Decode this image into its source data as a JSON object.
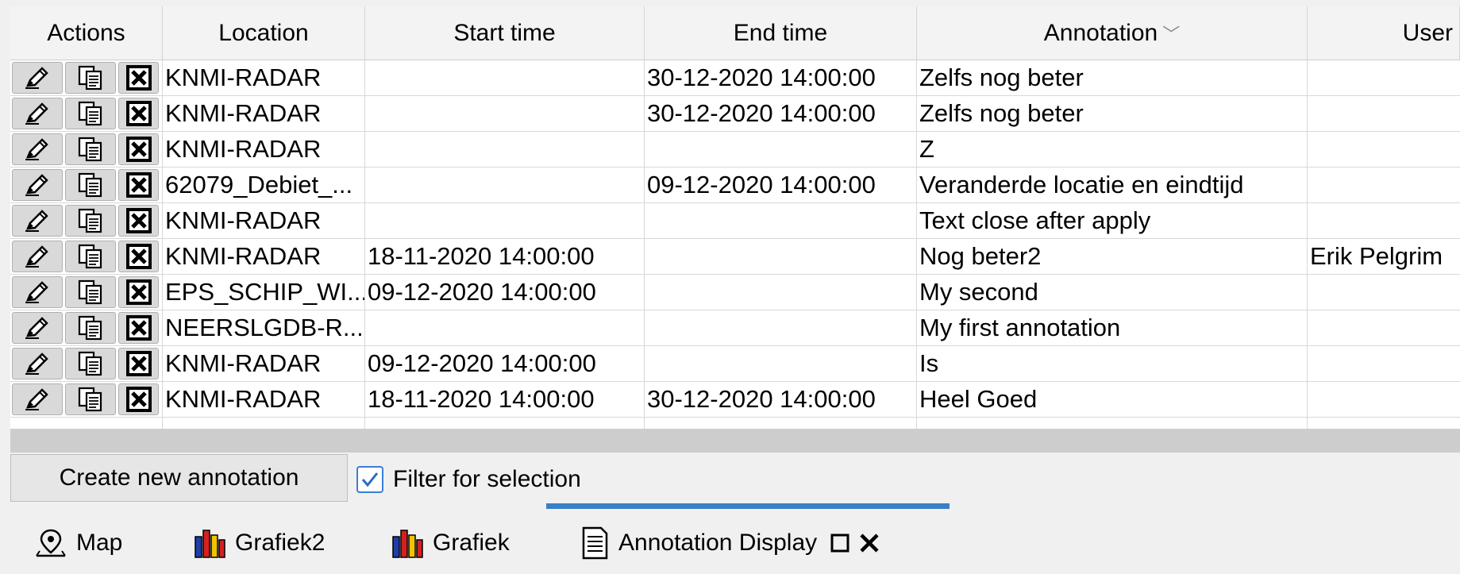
{
  "table": {
    "headers": {
      "actions": "Actions",
      "location": "Location",
      "start": "Start time",
      "end": "End time",
      "annotation": "Annotation",
      "user": "User"
    },
    "rows": [
      {
        "location": "KNMI-RADAR",
        "start": "",
        "end": "30-12-2020 14:00:00",
        "annotation": "Zelfs nog beter",
        "user": ""
      },
      {
        "location": "KNMI-RADAR",
        "start": "",
        "end": "30-12-2020 14:00:00",
        "annotation": "Zelfs nog beter",
        "user": ""
      },
      {
        "location": "KNMI-RADAR",
        "start": "",
        "end": "",
        "annotation": "Z",
        "user": ""
      },
      {
        "location": "62079_Debiet_...",
        "start": "",
        "end": "09-12-2020 14:00:00",
        "annotation": "Veranderde locatie en eindtijd",
        "user": ""
      },
      {
        "location": "KNMI-RADAR",
        "start": "",
        "end": "",
        "annotation": "Text close after apply",
        "user": ""
      },
      {
        "location": "KNMI-RADAR",
        "start": "18-11-2020 14:00:00",
        "end": "",
        "annotation": "Nog beter2",
        "user": "Erik Pelgrim"
      },
      {
        "location": "EPS_SCHIP_WI...",
        "start": "09-12-2020 14:00:00",
        "end": "",
        "annotation": "My second",
        "user": ""
      },
      {
        "location": "NEERSLGDB-R...",
        "start": "",
        "end": "",
        "annotation": "My first annotation",
        "user": ""
      },
      {
        "location": "KNMI-RADAR",
        "start": "09-12-2020 14:00:00",
        "end": "",
        "annotation": "Is",
        "user": ""
      },
      {
        "location": "KNMI-RADAR",
        "start": "18-11-2020 14:00:00",
        "end": "30-12-2020 14:00:00",
        "annotation": "Heel Goed",
        "user": ""
      }
    ],
    "row_actions": {
      "edit_icon": "pencil-icon",
      "copy_icon": "copy-icon",
      "delete_icon": "delete-x-icon"
    }
  },
  "footer": {
    "create_button_label": "Create new annotation",
    "filter_label": "Filter for selection",
    "filter_checked": true
  },
  "tabs": [
    {
      "label": "Map",
      "icon": "map-pin-icon"
    },
    {
      "label": "Grafiek2",
      "icon": "bar-chart-icon"
    },
    {
      "label": "Grafiek",
      "icon": "bar-chart-icon"
    },
    {
      "label": "Annotation Display",
      "icon": "document-icon",
      "active": true
    }
  ],
  "colors": {
    "accent": "#3a7fc7",
    "header_bg": "#f3f3f3",
    "button_bg": "#d9d9d9"
  }
}
